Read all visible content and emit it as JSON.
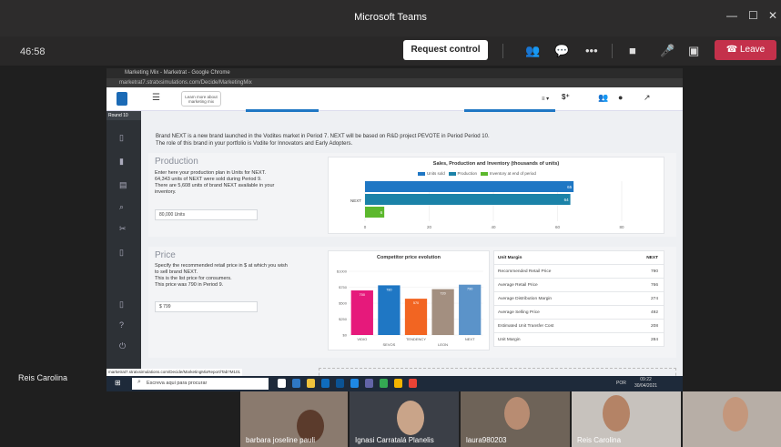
{
  "window": {
    "title": "Microsoft Teams"
  },
  "meeting": {
    "timer": "46:58",
    "request_control_label": "Request control",
    "leave_label": "Leave",
    "active_speaker": "Reis Carolina"
  },
  "browser": {
    "window_title": "Marketing Mix - Marketrat - Google Chrome",
    "address": "marketrat7.stratxsimulations.com/Decide/MarketingMix"
  },
  "app": {
    "learn_more_label": "Learn more about marketing mix",
    "round_label": "Round 10",
    "intro_line1": "Brand NEXT is a new brand launched in the Vodites market in Period 7. NEXT will be based on R&D project PEVOTE in Period Period 10.",
    "intro_line2": "The role of this brand in your portfolio is Vodite for Innovators and Early Adopters.",
    "production": {
      "title": "Production",
      "text": [
        "Enter here your production plan in Units for NEXT.",
        "64,343 units of NEXT were sold during Period 9.",
        "There are 5,608 units of brand NEXT available in your",
        "inventory."
      ],
      "input_value": "80,000 Units"
    },
    "price": {
      "title": "Price",
      "text": [
        "Specify the recommended retail price in $ at which you wish",
        "to sell brand NEXT.",
        "This is the list price for consumers.",
        "This price was 790 in Period 9."
      ],
      "input_value": "$ 799"
    },
    "margin_table": {
      "header": [
        "Unit Margin",
        "NEXT"
      ],
      "rows": [
        [
          "Recommended Retail Price",
          "790"
        ],
        [
          "Average Retail Price",
          "766"
        ],
        [
          "Average Distribution Margin",
          "274"
        ],
        [
          "Average Selling Price",
          "492"
        ],
        [
          "Estimated Unit Transfer Cost",
          "208"
        ],
        [
          "Unit Margin",
          "284"
        ]
      ]
    },
    "status_link": "marketrat7.stratxsimulations.com/Decide/MarketingMixReport/Tab?M101",
    "taskbar_search": "Escreva aqui para procurar",
    "taskbar_time": "09:22",
    "taskbar_date": "30/04/2021",
    "taskbar_lang": "POR"
  },
  "participants": [
    {
      "name": "barbara joseline pauli"
    },
    {
      "name": "Ignasi Carratalá Planelis"
    },
    {
      "name": "laura980203"
    },
    {
      "name": "Reis Carolina"
    },
    {
      "name": ""
    }
  ],
  "chart_data": [
    {
      "type": "bar",
      "orientation": "horizontal",
      "title": "Sales, Production and Inventory (thousands of units)",
      "categories": [
        "NEXT"
      ],
      "series": [
        {
          "name": "Units sold",
          "values": [
            65
          ],
          "color": "#1f77c4"
        },
        {
          "name": "Production",
          "values": [
            64
          ],
          "color": "#1b82a8"
        },
        {
          "name": "Inventory at end of period",
          "values": [
            6
          ],
          "color": "#5cb82d"
        }
      ],
      "xticks": [
        "0",
        "20",
        "40",
        "60",
        "80"
      ],
      "xlim": [
        0,
        80
      ]
    },
    {
      "type": "bar",
      "title": "Competitor price evolution",
      "categories": [
        "VIDIO",
        "SEVOS",
        "TENDENCY",
        "LEON",
        "NEXT"
      ],
      "values": [
        700,
        780,
        570,
        720,
        790
      ],
      "colors": [
        "#e6197b",
        "#1f77c4",
        "#f26522",
        "#a38f80",
        "#5b93c9"
      ],
      "yticks": [
        "$1000",
        "$750",
        "$500",
        "$250",
        "$0"
      ],
      "ylim": [
        0,
        1000
      ]
    }
  ]
}
